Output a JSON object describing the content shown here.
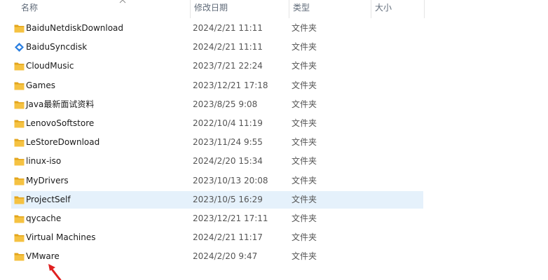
{
  "columns": {
    "name": "名称",
    "date": "修改日期",
    "type": "类型",
    "size": "大小"
  },
  "colors": {
    "folder": "#f5c242",
    "folder_dark": "#e3a51c",
    "selected": "#e5f1fb",
    "baidu_sync": "#2b7fe0",
    "arrow": "#e02020"
  },
  "rows": [
    {
      "name": "BaiduNetdiskDownload",
      "date": "2024/2/21 11:11",
      "type": "文件夹",
      "icon": "folder-icon"
    },
    {
      "name": "BaiduSyncdisk",
      "date": "2024/2/21 11:11",
      "type": "文件夹",
      "icon": "baidu-syncdisk-icon"
    },
    {
      "name": "CloudMusic",
      "date": "2023/7/21 22:24",
      "type": "文件夹",
      "icon": "folder-icon"
    },
    {
      "name": "Games",
      "date": "2023/12/21 17:18",
      "type": "文件夹",
      "icon": "folder-icon"
    },
    {
      "name": "Java最新面试资料",
      "date": "2023/8/25 9:08",
      "type": "文件夹",
      "icon": "folder-icon"
    },
    {
      "name": "LenovoSoftstore",
      "date": "2022/10/4 11:19",
      "type": "文件夹",
      "icon": "folder-icon"
    },
    {
      "name": "LeStoreDownload",
      "date": "2023/11/24 9:55",
      "type": "文件夹",
      "icon": "folder-icon"
    },
    {
      "name": "linux-iso",
      "date": "2024/2/20 15:34",
      "type": "文件夹",
      "icon": "folder-icon"
    },
    {
      "name": "MyDrivers",
      "date": "2023/10/13 20:08",
      "type": "文件夹",
      "icon": "folder-icon"
    },
    {
      "name": "ProjectSelf",
      "date": "2023/10/5 16:29",
      "type": "文件夹",
      "icon": "folder-icon",
      "selected": true
    },
    {
      "name": "qycache",
      "date": "2023/12/21 17:11",
      "type": "文件夹",
      "icon": "folder-icon"
    },
    {
      "name": "Virtual Machines",
      "date": "2024/2/21 11:17",
      "type": "文件夹",
      "icon": "folder-icon"
    },
    {
      "name": "VMware",
      "date": "2024/2/20 9:47",
      "type": "文件夹",
      "icon": "folder-icon"
    }
  ]
}
